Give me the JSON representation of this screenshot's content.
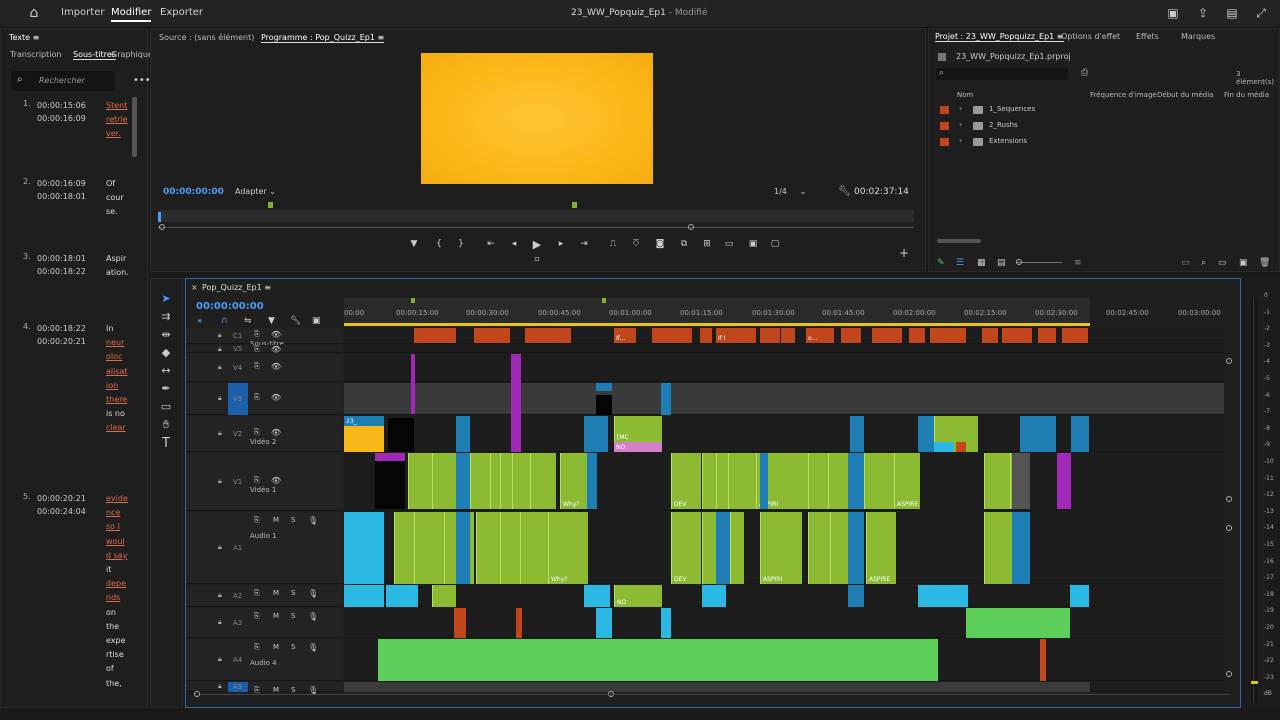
{
  "topbar": {
    "home": "home-icon",
    "nav": [
      "Importer",
      "Modifier",
      "Exporter"
    ],
    "title": "23_WW_Popquiz_Ep1",
    "title_suffix": "- Modifié"
  },
  "text_panel": {
    "title": "Texte",
    "tabs": [
      "Transcription",
      "Sous-titres",
      "Graphique"
    ],
    "search_placeholder": "Rechercher",
    "subtitles": [
      {
        "idx": "1.",
        "in": "00:00:15:06",
        "out": "00:00:16:09",
        "words": [
          "Stent",
          "retrie",
          "ver."
        ]
      },
      {
        "idx": "2.",
        "in": "00:00:16:09",
        "out": "00:00:18:01",
        "words": [
          "Of",
          "cour",
          "se."
        ]
      },
      {
        "idx": "3.",
        "in": "00:00:18:01",
        "out": "00:00:18:22",
        "words": [
          "Aspir",
          "ation."
        ]
      },
      {
        "idx": "4.",
        "in": "00:00:18:22",
        "out": "00:00:20:21",
        "words": [
          "In",
          "neur",
          "oloc",
          "alisat",
          "ion",
          "there",
          "is no",
          "clear"
        ]
      },
      {
        "idx": "5.",
        "in": "00:00:20:21",
        "out": "00:00:24:04",
        "words": [
          "evide",
          "nce",
          "so I",
          "woul",
          "d say",
          "it",
          "depe",
          "nds",
          "on",
          "the",
          "expe",
          "rtise",
          "of",
          "the,"
        ]
      }
    ]
  },
  "source_tab": "Source : (sans élément)",
  "program": {
    "tab": "Programme : Pop_Quizz_Ep1",
    "timecode": "00:00:00:00",
    "fit": "Adapter",
    "resolution": "1/4",
    "duration": "00:02:37:14"
  },
  "project": {
    "tabs": [
      "Projet : 23_WW_Popquizz_Ep1",
      "Options d'effet",
      "Effets",
      "Marques"
    ],
    "file": "23_WW_Popquizz_Ep1.prproj",
    "count": "3 élément(s)",
    "columns": [
      "Nom",
      "Fréquence d'image",
      "Début du média",
      "Fin du média"
    ],
    "items": [
      "1_Sequences",
      "2_Rushs",
      "Extensions"
    ]
  },
  "timeline": {
    "tab": "Pop_Quizz_Ep1",
    "timecode": "00:00:00:00",
    "ruler": [
      "00:00",
      "00:00:15:00",
      "00:00:30:00",
      "00:00:45:00",
      "00:01:00:00",
      "00:01:15:00",
      "00:01:30:00",
      "00:01:45:00",
      "00:02:00:00",
      "00:02:15:00",
      "00:02:30:00",
      "00:02:45:00",
      "00:03:00:00"
    ],
    "tracks": {
      "c1": "C1",
      "c1_name": "Sous-titre",
      "v5": "V5",
      "v4": "V4",
      "v3": "V3",
      "v2": "V2",
      "v2_name": "Vidéo 2",
      "v1": "V1",
      "v1_name": "Vidéo 1",
      "a1": "A1",
      "a1_name": "Audio 1",
      "a2": "A2",
      "a3": "A3",
      "a4": "A4",
      "a4_name": "Audio 4",
      "a5": "A5"
    },
    "clip_labels": {
      "l23": "23_",
      "mc": "[MC",
      "no": "NO",
      "why": "Why?",
      "dev": "DEV",
      "aspir": "ASPIRI",
      "aspire": "ASPIRE",
      "if": "If...",
      "ifi": "If I",
      "o": "o..."
    },
    "meter_ticks": [
      "0",
      "-1",
      "-2",
      "-3",
      "-4",
      "-5",
      "-6",
      "-7",
      "-8",
      "-9",
      "-10",
      "-11",
      "-12",
      "-13",
      "-14",
      "-15",
      "-16",
      "-17",
      "-18",
      "-19",
      "-20",
      "-21",
      "-22",
      "-23",
      "dB"
    ]
  }
}
